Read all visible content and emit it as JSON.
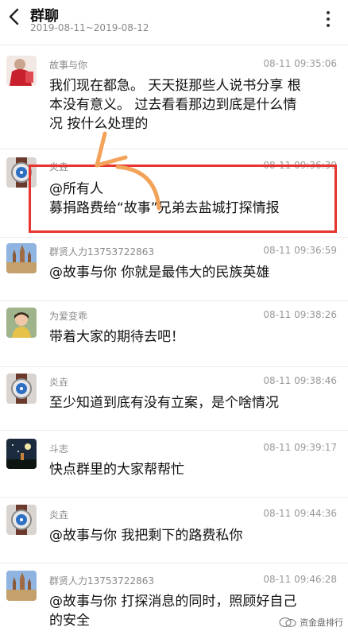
{
  "header": {
    "title": "群聊",
    "subtitle": "2019-08-11~2019-08-12",
    "back_icon": "chevron-left-icon",
    "more_icon": "more-vertical-icon"
  },
  "messages": [
    {
      "sender": "故事与你",
      "time": "08-11 09:35:06",
      "lines": [
        "我们现在都急。 天天挺那些人说书分享 根",
        "本没有意义。  过去看看那边到底是什么情",
        "况 按什么处理的"
      ],
      "avatar": "red-sweater-avatar"
    },
    {
      "sender": "炎垚",
      "time": "08-11 09:36:39",
      "lines": [
        "@所有人",
        "募捐路费给“故事”兄弟去盐城打探情报"
      ],
      "avatar": "watch-avatar"
    },
    {
      "sender": "群贤人力13753722863",
      "time": "08-11 09:36:59",
      "lines": [
        "@故事与你 你就是最伟大的民族英雄"
      ],
      "avatar": "castle-avatar"
    },
    {
      "sender": "为爱变乖",
      "time": "08-11 09:38:26",
      "lines": [
        "带着大家的期待去吧！"
      ],
      "avatar": "child-avatar"
    },
    {
      "sender": "炎垚",
      "time": "08-11 09:38:46",
      "lines": [
        "至少知道到底有没有立案，是个啥情况"
      ],
      "avatar": "watch-avatar"
    },
    {
      "sender": "斗志",
      "time": "08-11 09:39:17",
      "lines": [
        "快点群里的大家帮帮忙"
      ],
      "avatar": "night-sky-avatar"
    },
    {
      "sender": "炎垚",
      "time": "08-11 09:44:36",
      "lines": [
        "@故事与你 我把剩下的路费私你"
      ],
      "avatar": "watch-avatar"
    },
    {
      "sender": "群贤人力13753722863",
      "time": "08-11 09:46:28",
      "lines": [
        "@故事与你 打探消息的同时，照顾好自己",
        "的安全"
      ],
      "avatar": "castle-avatar"
    }
  ],
  "watermark": {
    "text": "资金盘排行",
    "icon": "wechat-icon"
  },
  "colors": {
    "highlight": "#e8332e",
    "arrow": "#f3a25a"
  }
}
